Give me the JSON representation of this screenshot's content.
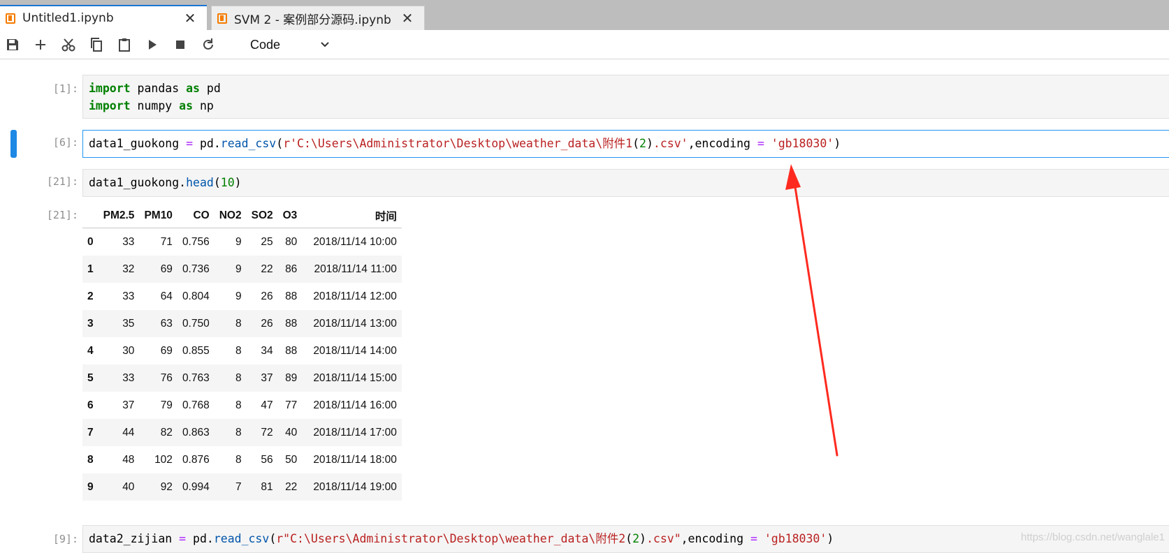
{
  "tabs": [
    {
      "label": "Untitled1.ipynb",
      "active": true,
      "icon": "notebook-icon"
    },
    {
      "label": "SVM 2 - 案例部分源码.ipynb",
      "active": false,
      "icon": "notebook-icon"
    }
  ],
  "toolbar": {
    "buttons": [
      "save-icon",
      "add-icon",
      "cut-icon",
      "copy-icon",
      "paste-icon",
      "run-icon",
      "stop-icon",
      "restart-icon"
    ],
    "cell_type": "Code"
  },
  "cells": [
    {
      "prompt": "[1]:",
      "lines": [
        "import pandas as pd",
        "import numpy as np"
      ]
    },
    {
      "prompt": "[6]:",
      "line": "data1_guokong = pd.read_csv(r'C:\\Users\\Administrator\\Desktop\\weather_data\\附件1(2).csv',encoding = 'gb18030')",
      "active": true
    },
    {
      "prompt": "[21]:",
      "line": "data1_guokong.head(10)"
    },
    {
      "prompt": "[9]:",
      "line": "data2_zijian = pd.read_csv(r\"C:\\Users\\Administrator\\Desktop\\weather_data\\附件2(2).csv\",encoding = 'gb18030')"
    }
  ],
  "output": {
    "prompt": "[21]:",
    "columns": [
      "",
      "PM2.5",
      "PM10",
      "CO",
      "NO2",
      "SO2",
      "O3",
      "时间"
    ],
    "rows": [
      [
        "0",
        "33",
        "71",
        "0.756",
        "9",
        "25",
        "80",
        "2018/11/14 10:00"
      ],
      [
        "1",
        "32",
        "69",
        "0.736",
        "9",
        "22",
        "86",
        "2018/11/14 11:00"
      ],
      [
        "2",
        "33",
        "64",
        "0.804",
        "9",
        "26",
        "88",
        "2018/11/14 12:00"
      ],
      [
        "3",
        "35",
        "63",
        "0.750",
        "8",
        "26",
        "88",
        "2018/11/14 13:00"
      ],
      [
        "4",
        "30",
        "69",
        "0.855",
        "8",
        "34",
        "88",
        "2018/11/14 14:00"
      ],
      [
        "5",
        "33",
        "76",
        "0.763",
        "8",
        "37",
        "89",
        "2018/11/14 15:00"
      ],
      [
        "6",
        "37",
        "79",
        "0.768",
        "8",
        "47",
        "77",
        "2018/11/14 16:00"
      ],
      [
        "7",
        "44",
        "82",
        "0.863",
        "8",
        "72",
        "40",
        "2018/11/14 17:00"
      ],
      [
        "8",
        "48",
        "102",
        "0.876",
        "8",
        "56",
        "50",
        "2018/11/14 18:00"
      ],
      [
        "9",
        "40",
        "92",
        "0.994",
        "7",
        "81",
        "22",
        "2018/11/14 19:00"
      ]
    ]
  },
  "watermark": "https://blog.csdn.net/wanglale1",
  "colors": {
    "accent": "#1976d2",
    "annotation_arrow": "#ff2a1f",
    "notebook_icon": "#f57c00"
  }
}
